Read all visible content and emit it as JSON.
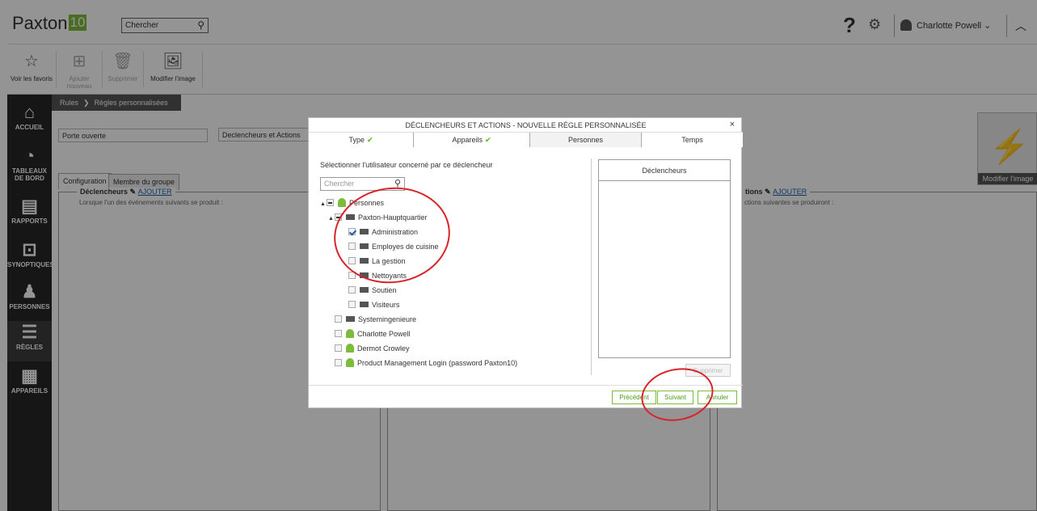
{
  "app": {
    "logo": "Paxton",
    "logo_badge": "10"
  },
  "topbar": {
    "search_placeholder": "Chercher",
    "help": "?",
    "user_name": "Charlotte Powell"
  },
  "toolbar": {
    "items": [
      {
        "label": "Voir les favoris",
        "icon": "star-icon"
      },
      {
        "label": "Ajouter nouveau",
        "icon": "add-grid-icon"
      },
      {
        "label": "Supprimer",
        "icon": "trash-icon"
      },
      {
        "label": "Modifier l'image",
        "icon": "image-icon"
      }
    ]
  },
  "sidebar": {
    "items": [
      {
        "label": "ACCUEIL",
        "icon": "home-icon"
      },
      {
        "label": "TABLEAUX DE BORD",
        "icon": "dashboard-icon"
      },
      {
        "label": "RAPPORTS",
        "icon": "report-icon"
      },
      {
        "label": "SYNOPTIQUES",
        "icon": "floorplan-icon"
      },
      {
        "label": "PERSONNES",
        "icon": "person-icon"
      },
      {
        "label": "RÈGLES",
        "icon": "rules-icon"
      },
      {
        "label": "APPAREILS",
        "icon": "devices-icon"
      }
    ]
  },
  "main": {
    "breadcrumb": [
      "Rules",
      "Règles personnalisées"
    ],
    "name_value": "Porte ouverte",
    "type_value": "Declencheurs et Actions",
    "tabs": [
      "Configuration",
      "Membre du groupe"
    ],
    "triggers_title": "Déclencheurs",
    "triggers_add": "AJOUTER",
    "triggers_sub": "Lorsque l'un des événements suivants se produit :",
    "actions_title": "tions",
    "actions_add": "AJOUTER",
    "actions_sub": "ctions suivantes se produiront :",
    "image_caption": "Modifier l'image"
  },
  "dialog": {
    "title": "DÉCLENCHEURS ET ACTIONS - NOUVELLE RÈGLE PERSONNALISÉE",
    "close": "×",
    "tabs": [
      {
        "label": "Type",
        "done": true
      },
      {
        "label": "Appareils",
        "done": true
      },
      {
        "label": "Personnes",
        "done": false
      },
      {
        "label": "Temps",
        "done": false
      }
    ],
    "prompt": "Sélectionner l'utilisateur concerné par ce déclencheur",
    "search_placeholder": "Chercher",
    "tree": [
      {
        "label": "Personnes",
        "kind": "person",
        "level": 0,
        "state": "part",
        "toggle": "▲"
      },
      {
        "label": "Paxton-Hauptquartier",
        "kind": "folder",
        "level": 1,
        "state": "part",
        "toggle": "▲"
      },
      {
        "label": "Administration",
        "kind": "folder",
        "level": 2,
        "state": "on"
      },
      {
        "label": "Employes de cuisine",
        "kind": "folder",
        "level": 2,
        "state": "off"
      },
      {
        "label": "La gestion",
        "kind": "folder",
        "level": 2,
        "state": "off"
      },
      {
        "label": "Nettoyants",
        "kind": "folder",
        "level": 2,
        "state": "off"
      },
      {
        "label": "Soutien",
        "kind": "folder",
        "level": 2,
        "state": "off"
      },
      {
        "label": "Visiteurs",
        "kind": "folder",
        "level": 2,
        "state": "off"
      },
      {
        "label": "Systemingenieure",
        "kind": "folder",
        "level": 1,
        "state": "off"
      },
      {
        "label": "Charlotte Powell",
        "kind": "person",
        "level": 1,
        "state": "off"
      },
      {
        "label": "Dermot Crowley",
        "kind": "person",
        "level": 1,
        "state": "off"
      },
      {
        "label": "Product Management Login (password Paxton10)",
        "kind": "person",
        "level": 1,
        "state": "off"
      }
    ],
    "right_header": "Déclencheurs",
    "remove_label": "Supprimer",
    "footer": {
      "prev": "Précédent",
      "next": "Suivant",
      "cancel": "Annuler"
    }
  },
  "colors": {
    "accent": "#7dbb3c",
    "annotation": "#d9232a",
    "sidebar": "#262626"
  }
}
